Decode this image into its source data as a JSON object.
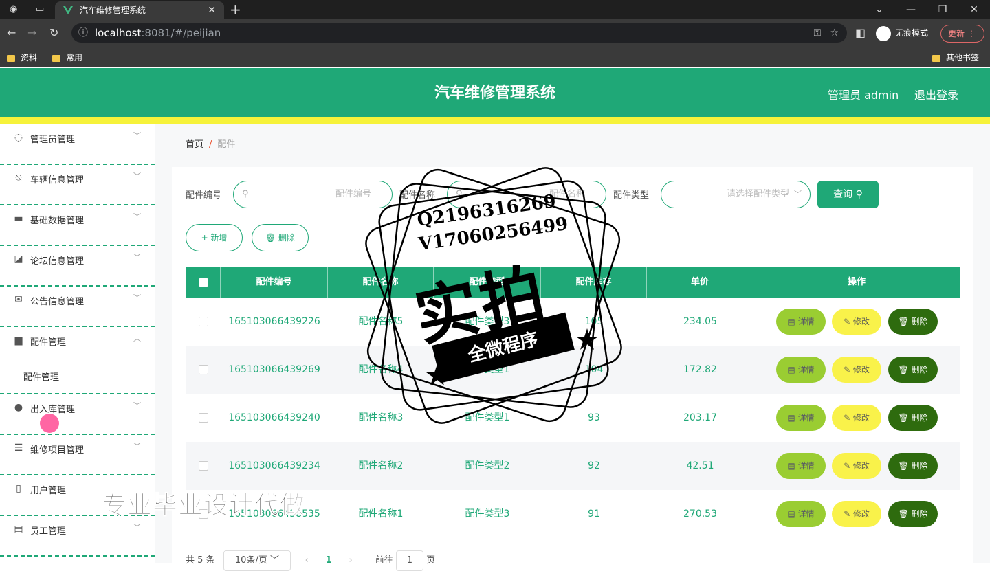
{
  "browser": {
    "tab_title": "汽车维修管理系统",
    "url_host": "localhost",
    "url_rest": ":8081/#/peijian",
    "incognito_label": "无痕模式",
    "update_label": "更新",
    "bookmarks": [
      "资料",
      "常用"
    ],
    "other_bookmarks": "其他书签"
  },
  "header": {
    "title": "汽车维修管理系统",
    "user": "管理员 admin",
    "logout": "退出登录"
  },
  "sidebar": {
    "items": [
      {
        "label": "管理员管理",
        "icon": "circle-icon"
      },
      {
        "label": "车辆信息管理",
        "icon": "bell-off-icon"
      },
      {
        "label": "基础数据管理",
        "icon": "monitor-icon"
      },
      {
        "label": "论坛信息管理",
        "icon": "chart-icon"
      },
      {
        "label": "公告信息管理",
        "icon": "mail-icon"
      },
      {
        "label": "配件管理",
        "icon": "box-icon"
      },
      {
        "label": "出入库管理",
        "icon": "user-icon"
      },
      {
        "label": "维修项目管理",
        "icon": "list-icon"
      },
      {
        "label": "用户管理",
        "icon": "phone-icon"
      },
      {
        "label": "员工管理",
        "icon": "briefcase-icon"
      }
    ],
    "submenu_label": "配件管理"
  },
  "breadcrumb": {
    "home": "首页",
    "sep": "/",
    "current": "配件"
  },
  "filters": {
    "code_label": "配件编号",
    "code_placeholder": "配件编号",
    "name_label": "配件名称",
    "name_placeholder": "配件名称",
    "type_label": "配件类型",
    "type_placeholder": "请选择配件类型",
    "query_label": "查询 ⚲"
  },
  "actions": {
    "add": "+ 新增",
    "delete": "🗑 删除"
  },
  "table": {
    "headers": [
      "配件编号",
      "配件名称",
      "配件类型",
      "配件库存",
      "单价",
      "操作"
    ],
    "rows": [
      {
        "code": "165103066439226",
        "name": "配件名称5",
        "type": "配件类型3",
        "stock": "105",
        "price": "234.05"
      },
      {
        "code": "165103066439269",
        "name": "配件名称4",
        "type": "配件类型1",
        "stock": "104",
        "price": "172.82"
      },
      {
        "code": "165103066439240",
        "name": "配件名称3",
        "type": "配件类型1",
        "stock": "93",
        "price": "203.17"
      },
      {
        "code": "165103066439234",
        "name": "配件名称2",
        "type": "配件类型2",
        "stock": "92",
        "price": "42.51"
      },
      {
        "code": "165103066438535",
        "name": "配件名称1",
        "type": "配件类型3",
        "stock": "91",
        "price": "270.53"
      }
    ],
    "row_buttons": {
      "detail": "▤ 详情",
      "edit": "✎ 修改",
      "delete": "🗑 删除"
    }
  },
  "pagination": {
    "total": "共 5 条",
    "size": "10条/页",
    "page": "1",
    "goto_prefix": "前往",
    "goto_value": "1",
    "goto_suffix": "页"
  },
  "watermark": {
    "qq": "Q2196316269",
    "wx": "V17060256499",
    "big": "实拍",
    "banner": "全微程序",
    "bottom": "专业毕业设计代做"
  },
  "colors": {
    "accent": "#1fa877",
    "header_stripe": "#f6f23a"
  }
}
